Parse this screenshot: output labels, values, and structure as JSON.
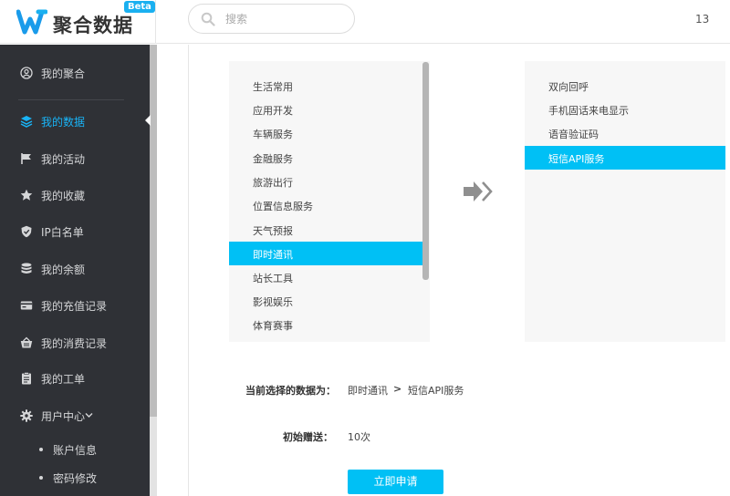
{
  "header": {
    "brand_name": "聚合数据",
    "beta_badge": "Beta",
    "search_placeholder": "搜索",
    "right_text": "13"
  },
  "sidebar": {
    "items": [
      {
        "label": "我的聚合",
        "icon": "user-circle-icon"
      },
      {
        "label": "我的数据",
        "icon": "layers-icon",
        "active": true
      },
      {
        "label": "我的活动",
        "icon": "flag-icon"
      },
      {
        "label": "我的收藏",
        "icon": "star-icon"
      },
      {
        "label": "IP白名单",
        "icon": "shield-icon"
      },
      {
        "label": "我的余额",
        "icon": "database-icon"
      },
      {
        "label": "我的充值记录",
        "icon": "credit-card-icon"
      },
      {
        "label": "我的消费记录",
        "icon": "shopping-basket-icon"
      },
      {
        "label": "我的工单",
        "icon": "clipboard-icon"
      },
      {
        "label": "用户中心",
        "icon": "gear-icon"
      }
    ],
    "sub_items": [
      {
        "label": "账户信息"
      },
      {
        "label": "密码修改"
      }
    ]
  },
  "categories": [
    {
      "label": "生活常用"
    },
    {
      "label": "应用开发"
    },
    {
      "label": "车辆服务"
    },
    {
      "label": "金融服务"
    },
    {
      "label": "旅游出行"
    },
    {
      "label": "位置信息服务"
    },
    {
      "label": "天气预报"
    },
    {
      "label": "即时通讯",
      "selected": true
    },
    {
      "label": "站长工具"
    },
    {
      "label": "影视娱乐"
    },
    {
      "label": "体育赛事"
    }
  ],
  "apis": [
    {
      "label": "双向回呼"
    },
    {
      "label": "手机固话来电显示"
    },
    {
      "label": "语音验证码"
    },
    {
      "label": "短信API服务",
      "selected": true
    }
  ],
  "form": {
    "current_label": "当前选择的数据为：",
    "current_category": "即时通讯",
    "separator": ">",
    "current_api": "短信API服务",
    "gift_label": "初始赠送：",
    "gift_value": "10次",
    "apply_button": "立即申请"
  },
  "colors": {
    "accent": "#00c0f5",
    "sidebar_bg": "#2f3136",
    "sidebar_active": "#19b4f7"
  }
}
